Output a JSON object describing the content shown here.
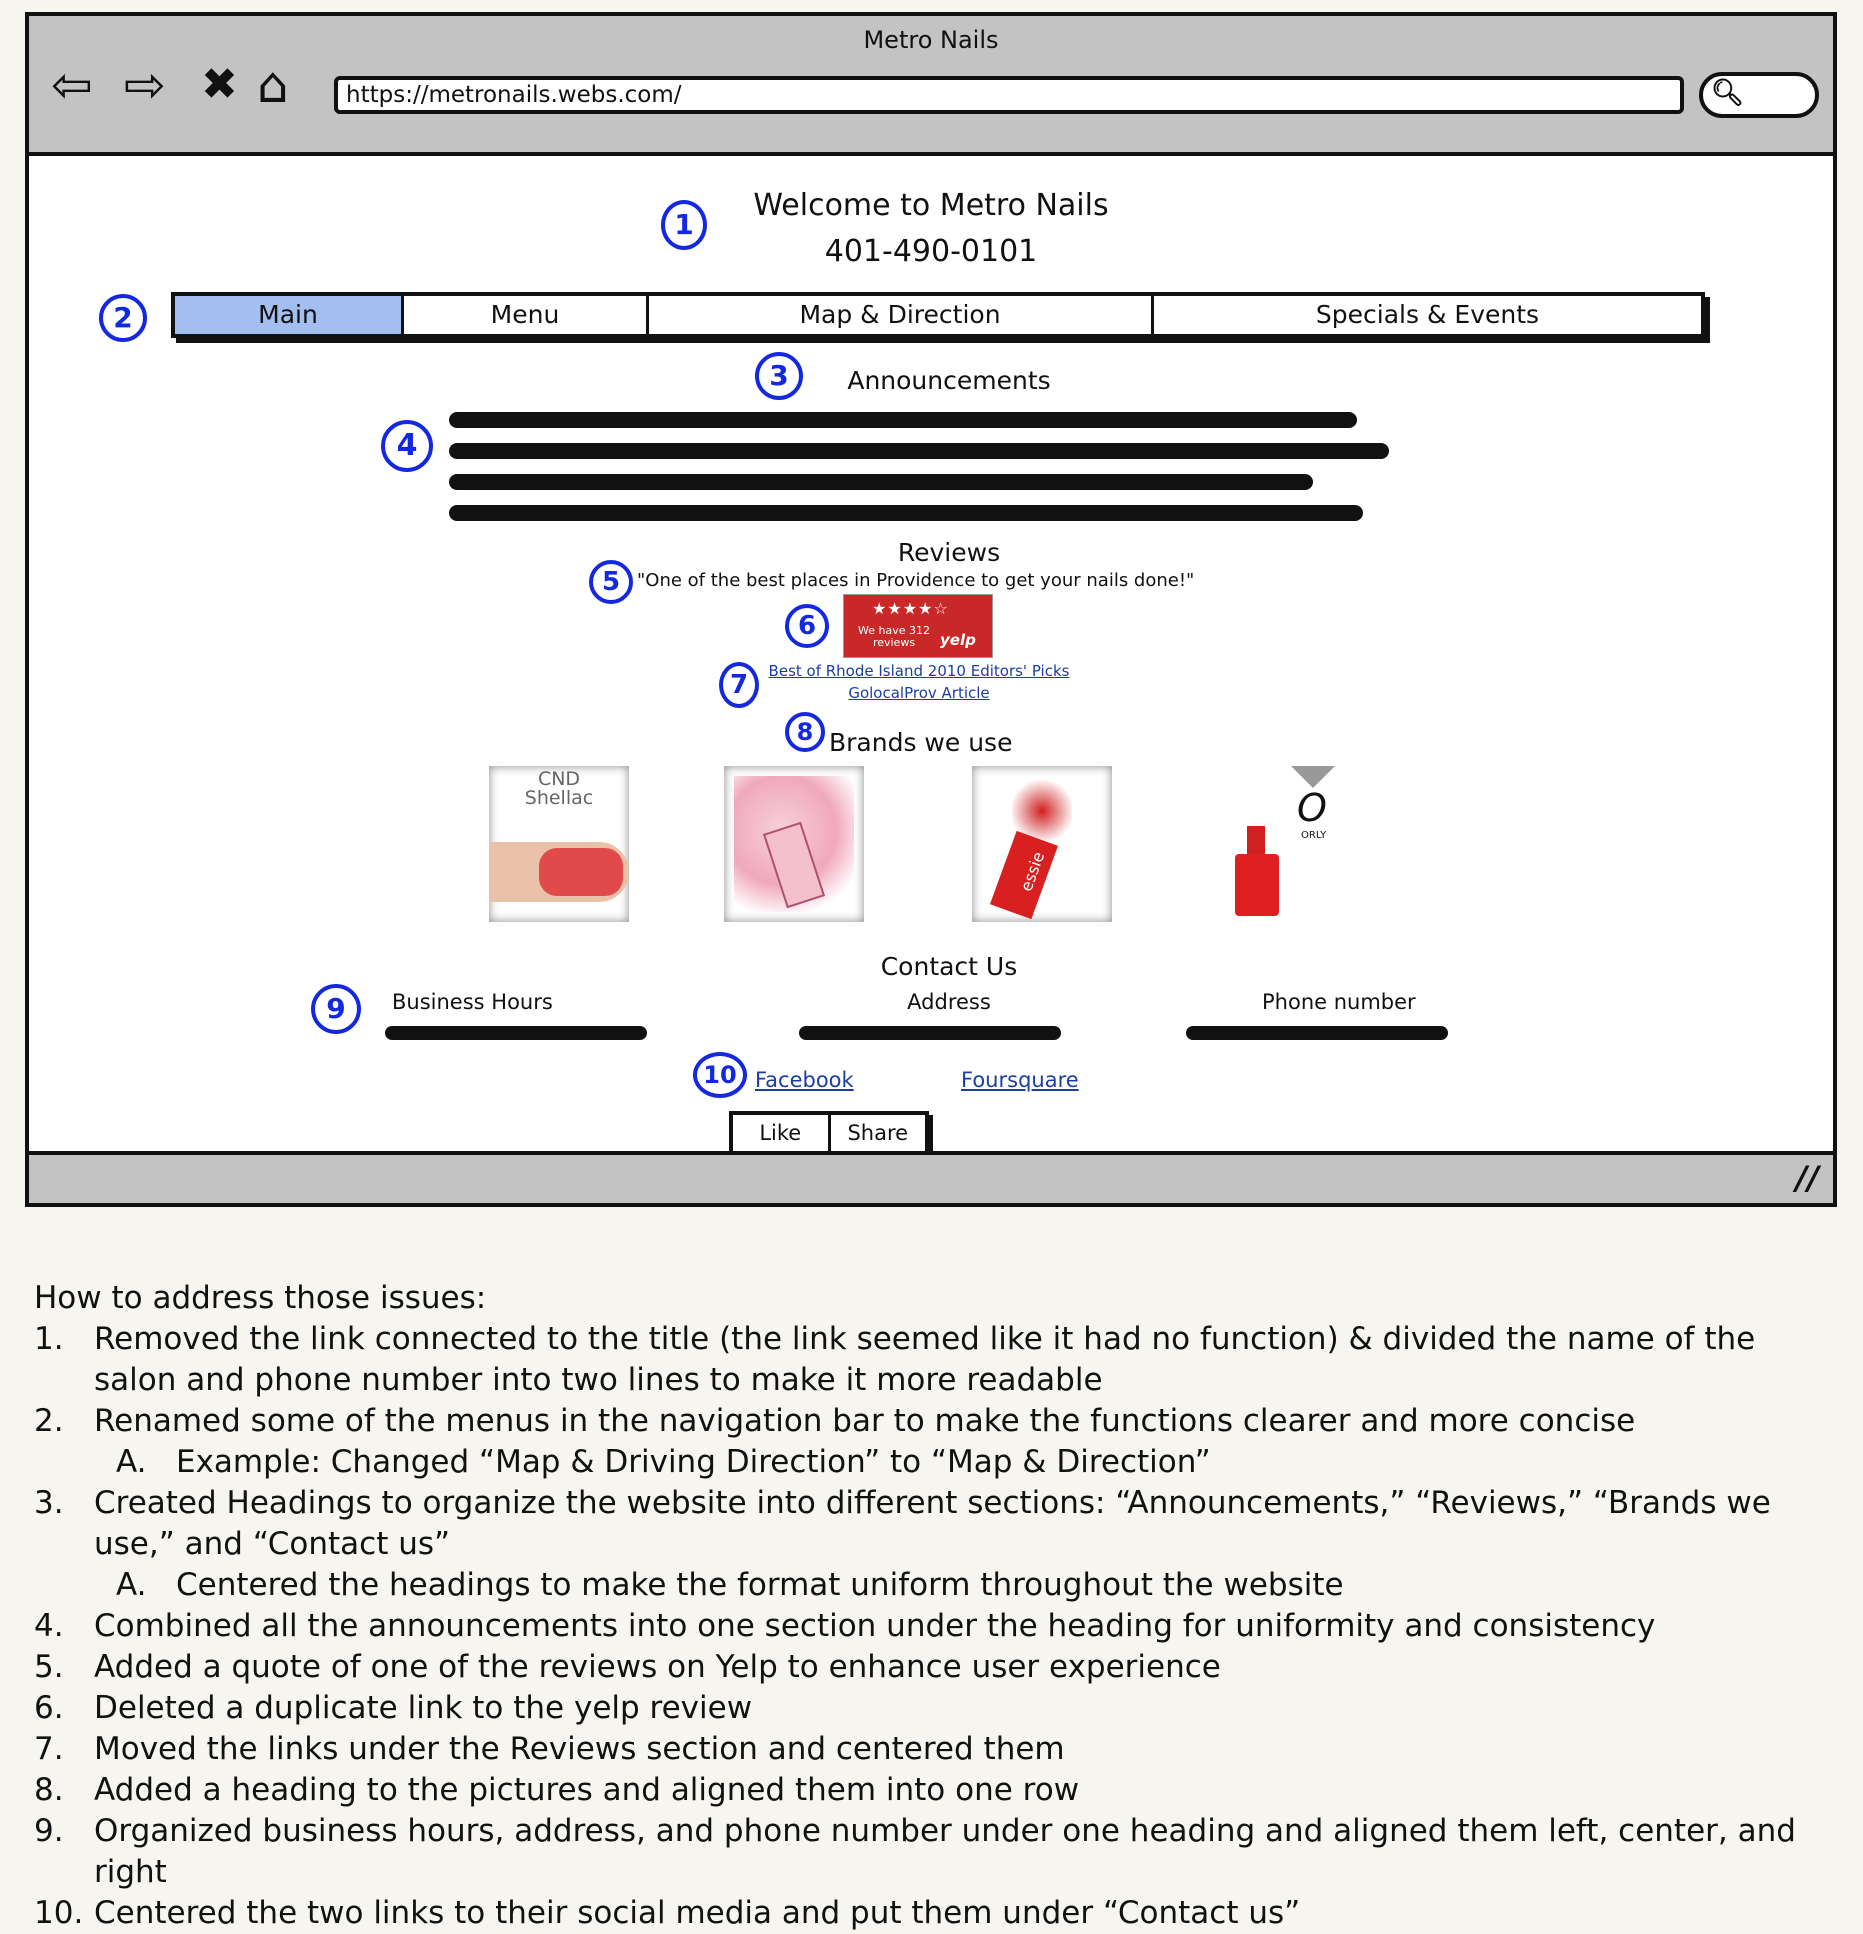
{
  "window": {
    "title": "Metro Nails",
    "url": "https://metronails.webs.com/"
  },
  "icons": [
    "back-arrow-icon",
    "forward-arrow-icon",
    "close-icon",
    "home-icon",
    "search-icon",
    "resize-grip-icon"
  ],
  "site": {
    "welcome": "Welcome to Metro Nails",
    "phone": "401-490-0101",
    "nav": [
      "Main",
      "Menu",
      "Map & Direction",
      "Specials & Events"
    ],
    "nav_active": "Main",
    "announcements_heading": "Announcements",
    "reviews_heading": "Reviews",
    "quote": "\"One of the best places in Providence to get your nails done!\"",
    "yelp": {
      "count_text": "We have 312 reviews",
      "logo": "yelp",
      "stars": 4
    },
    "links": [
      "Best of Rhode Island 2010 Editors' Picks",
      "GolocalProv Article"
    ],
    "brands_heading": "Brands we use",
    "brands": [
      {
        "label": "CND Shellac",
        "brand_color": "#e05050"
      },
      {
        "label": "",
        "brand_color": "#f0b0c0"
      },
      {
        "label": "essie",
        "brand_color": "#d02020"
      },
      {
        "label": "ORLY",
        "brand_color": "#e02020"
      }
    ],
    "contact_heading": "Contact Us",
    "contact_columns": [
      "Business Hours",
      "Address",
      "Phone number"
    ],
    "social": [
      "Facebook",
      "Foursquare"
    ],
    "buttons": [
      "Like",
      "Share"
    ]
  },
  "annotations": [
    "1",
    "2",
    "3",
    "4",
    "5",
    "6",
    "7",
    "8",
    "9",
    "10"
  ],
  "notes": {
    "intro": "How to address those issues:",
    "items": [
      {
        "n": "1.",
        "text": "Removed the link connected to the title (the link seemed like it had no function) & divided the name of the salon and phone number into two lines to make it more readable"
      },
      {
        "n": "2.",
        "text": "Renamed some of the menus in the navigation bar to make the functions clearer and more concise"
      },
      {
        "n": "A.",
        "text": "Example: Changed “Map & Driving Direction” to “Map & Direction”",
        "sub": true
      },
      {
        "n": "3.",
        "text": "Created Headings to organize the website into different sections: “Announcements,” “Reviews,” “Brands we use,” and “Contact us”"
      },
      {
        "n": "A.",
        "text": "Centered the headings to make the format uniform throughout the website",
        "sub": true
      },
      {
        "n": "4.",
        "text": "Combined all the announcements into one section under the heading for uniformity and consistency"
      },
      {
        "n": "5.",
        "text": "Added a quote of one of the reviews on Yelp to enhance user experience"
      },
      {
        "n": "6.",
        "text": "Deleted a duplicate link to the yelp review"
      },
      {
        "n": "7.",
        "text": "Moved the links under the Reviews section and centered them"
      },
      {
        "n": "8.",
        "text": "Added a heading to the pictures and aligned them into one row"
      },
      {
        "n": "9.",
        "text": "Organized business hours, address, and phone number under one heading and aligned them left, center, and right"
      },
      {
        "n": "10.",
        "text": "Centered the two links to their social media and put them under “Contact us”"
      }
    ]
  }
}
